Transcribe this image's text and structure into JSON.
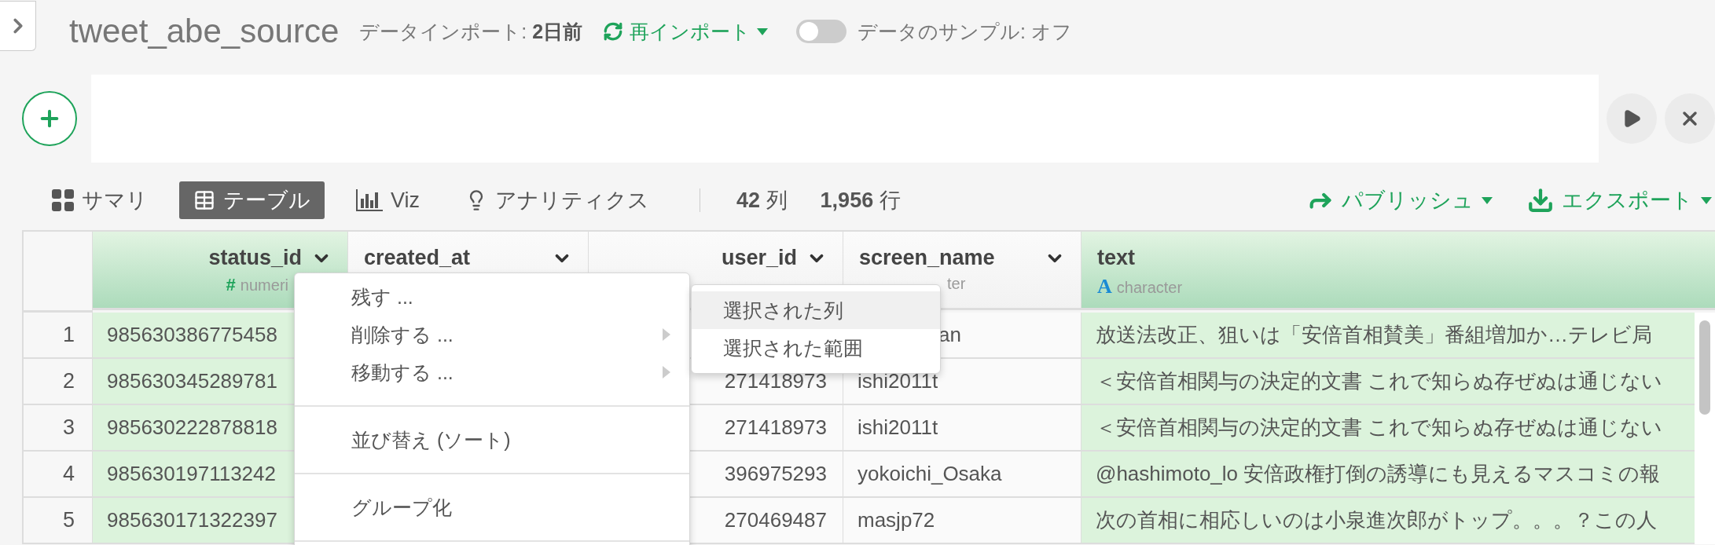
{
  "header": {
    "title": "tweet_abe_source",
    "import_info": "データインポート: **2日前**",
    "reimport": "再インポート",
    "sample": {
      "on": false,
      "label": "データのサンプル: オフ"
    }
  },
  "view_tabs": [
    {
      "label": "サマリ",
      "kind": "summary",
      "selected": false
    },
    {
      "label": "テーブル",
      "kind": "table",
      "selected": true
    },
    {
      "label": "Viz",
      "kind": "viz",
      "selected": false
    },
    {
      "label": "アナリティクス",
      "kind": "analytics",
      "selected": false
    }
  ],
  "stats": [
    {
      "value": "42",
      "unit": "列"
    },
    {
      "value": "1,956",
      "unit": "行"
    }
  ],
  "actions": [
    {
      "label": "パブリッシュ",
      "kind": "publish"
    },
    {
      "label": "エクスポート",
      "kind": "export"
    }
  ],
  "table": {
    "columns": [
      {
        "name": "status_id",
        "selected": true,
        "type": {
          "icon": "#",
          "label": "numeri"
        }
      },
      {
        "name": "created_at",
        "selected": false
      },
      {
        "name": "user_id",
        "selected": false
      },
      {
        "name": "screen_name",
        "selected": false,
        "type": {
          "label": "ter"
        }
      },
      {
        "name": "text",
        "selected": true,
        "type": {
          "icon": "A",
          "label": "character"
        }
      }
    ],
    "rows": [
      {
        "number": "1",
        "status_id": "985630386775458",
        "screen_name": "an",
        "text": "放送法改正、狙いは「安倍首相賛美」番組増加か…テレビ局"
      },
      {
        "number": "2",
        "status_id": "985630345289781",
        "user_id": "271418973",
        "screen_name": "ishi2011t",
        "text": "＜安倍首相関与の決定的文書 これで知らぬ存ぜぬは通じない"
      },
      {
        "number": "3",
        "status_id": "985630222878818",
        "user_id": "271418973",
        "screen_name": "ishi2011t",
        "text": "＜安倍首相関与の決定的文書 これで知らぬ存ぜぬは通じない"
      },
      {
        "number": "4",
        "status_id": "985630197113242",
        "user_id": "396975293",
        "screen_name": "yokoichi_Osaka",
        "text": "@hashimoto_lo 安倍政権打倒の誘導にも見えるマスコミの報"
      },
      {
        "number": "5",
        "status_id": "985630171322397",
        "user_id": "270469487",
        "screen_name": "masjp72",
        "text": "次の首相に相応しいのは小泉進次郎がトップ。。。？この人"
      }
    ]
  },
  "column_menu": {
    "items": [
      {
        "label": "残す ...",
        "arrow": false,
        "divider_after": false
      },
      {
        "label": "削除する ...",
        "arrow": true,
        "divider_after": false,
        "children": [
          {
            "label": "選択された列",
            "selected": true
          },
          {
            "label": "選択された範囲",
            "selected": false
          }
        ]
      },
      {
        "label": "移動する ...",
        "arrow": true,
        "divider_after": true
      },
      {
        "label": "並び替え (ソート)",
        "arrow": false,
        "divider_after": true
      },
      {
        "label": "グループ化",
        "arrow": false,
        "divider_after": true
      }
    ]
  }
}
